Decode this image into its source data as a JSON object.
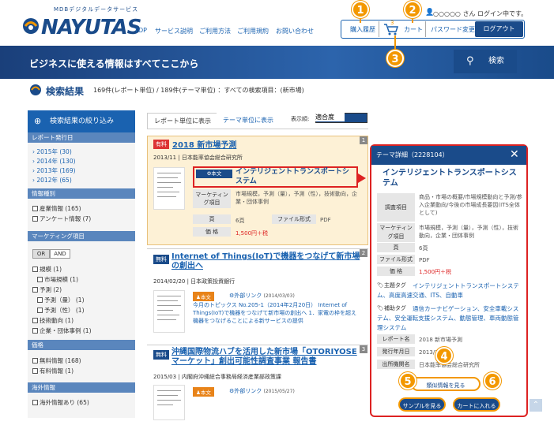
{
  "header": {
    "logo_sub": "MDBデジタルデータサービス",
    "logo": "NAYUTAS",
    "nav": [
      "TOP",
      "サービス説明",
      "ご利用方法",
      "ご利用規約",
      "お問い合わせ"
    ],
    "user_status": "○○○○○ さん ログイン中です。",
    "purchase_history": "購入履歴",
    "cart_count": "3",
    "cart": "カート",
    "password_change": "パスワード変更",
    "logout": "ログアウト"
  },
  "banner": {
    "text": "ビジネスに使える情報はすべてここから",
    "search_button": "検索"
  },
  "results": {
    "title": "検索結果",
    "summary": "169件(レポート単位) / 189件(テーマ単位) ：すべての検索項目：(新市場)"
  },
  "sidebar": {
    "title": "検索結果の絞り込み",
    "sections": [
      {
        "title": "レポート発行日",
        "items": [
          "2015年 (30)",
          "2014年 (130)",
          "2013年 (169)",
          "2012年 (65)"
        ]
      },
      {
        "title": "情報種別",
        "items": [
          "産業情報 (165)",
          "アンケート情報 (7)"
        ]
      },
      {
        "title": "マーケティング項目",
        "or": "OR",
        "and": "AND",
        "items": [
          "規模 (1)",
          "市場規模 (1)",
          "予測 (2)",
          "予測（量） (1)",
          "予測（性） (1)",
          "技術動向 (1)",
          "企業・団体事例 (1)"
        ]
      },
      {
        "title": "価格",
        "items": [
          "無料情報 (168)",
          "有料情報 (1)"
        ]
      },
      {
        "title": "海外情報",
        "items": [
          "海外情報あり (65)"
        ]
      }
    ]
  },
  "tabs": {
    "report": "レポート単位に表示",
    "theme": "テーマ単位に表示",
    "sort_label": "表示順:",
    "sort_value": "適合度"
  },
  "cards": [
    {
      "index": "1",
      "badge": "有料",
      "title": "2018 新市場予測",
      "meta": "2013/11 | 日本能率協会総合研究所",
      "theme_label": "本文",
      "theme": "インテリジェントトランスポートシステム",
      "rows": [
        {
          "k": "マーケティング項目",
          "v": "市場規模，予測（量），予測（性），技術動向，企業・団体事例"
        },
        {
          "k": "頁",
          "v": "6頁"
        },
        {
          "k": "ファイル形式",
          "v": "PDF"
        },
        {
          "k": "価 格",
          "v": "1,500円＋税"
        }
      ]
    },
    {
      "index": "2",
      "badge": "無料",
      "title": "Internet of Things(IoT)で機器をつなげて新市場の創出へ",
      "meta": "2014/02/20 | 日本政策投資銀行",
      "theme_label": "本文",
      "link": "外部リンク",
      "link_date": "(2014/03/03)",
      "desc": "今月のトピックス No.205-1（2014年2月20日） Internet of Things(IoT)で機器をつなげて新市場の創出へ 1．家電の枠を超え機器をつなげることによる新サービスの提供"
    },
    {
      "index": "3",
      "badge": "無料",
      "title": "沖縄国際物流ハブを活用した新市場「OTORIYOSEマーケット」創出可能性調査事業 報告書",
      "meta": "2015/03 | 内閣府沖縄総合事務局経済産業部政策課",
      "theme_label": "本文",
      "link": "外部リンク",
      "link_date": "(2015/05/27)"
    }
  ],
  "detail": {
    "header": "テーマ詳細（2228104）",
    "title": "インテリジェントトランスポートシステム",
    "rows": [
      {
        "k": "調査項目",
        "v": "商品・市場の概要/市場規模動向と予測/参入企業動向/今後の市場成長要因(ITS全体として)"
      },
      {
        "k": "マーケティング項目",
        "v": "市場規模，予測（量），予測（性），技術動向，企業・団体事例"
      },
      {
        "k": "頁",
        "v": "6頁"
      },
      {
        "k": "ファイル形式",
        "v": "PDF"
      },
      {
        "k": "価 格",
        "v": "1,500円＋税"
      }
    ],
    "main_tag_label": "主題タグ",
    "main_tags": "インテリジェントトランスポートシステム、高度高速交通、ITS、自動車",
    "sub_tag_label": "補助タグ",
    "sub_tags": "通信カーナビゲーション、安全車載システム、安全運転支援システム、動態管理、車両動態管理システム",
    "report_rows": [
      {
        "k": "レポート名",
        "v": "2018 新市場予測"
      },
      {
        "k": "発行年月日",
        "v": "2013/11"
      },
      {
        "k": "出所機関名",
        "v": "日本能率協会総合研究所"
      }
    ],
    "btn_detail": "類似情報を見る",
    "btn_sample": "サンプルを見る",
    "btn_cart": "カートに入れる"
  },
  "callouts": [
    "1",
    "2",
    "3",
    "4",
    "5",
    "6"
  ]
}
